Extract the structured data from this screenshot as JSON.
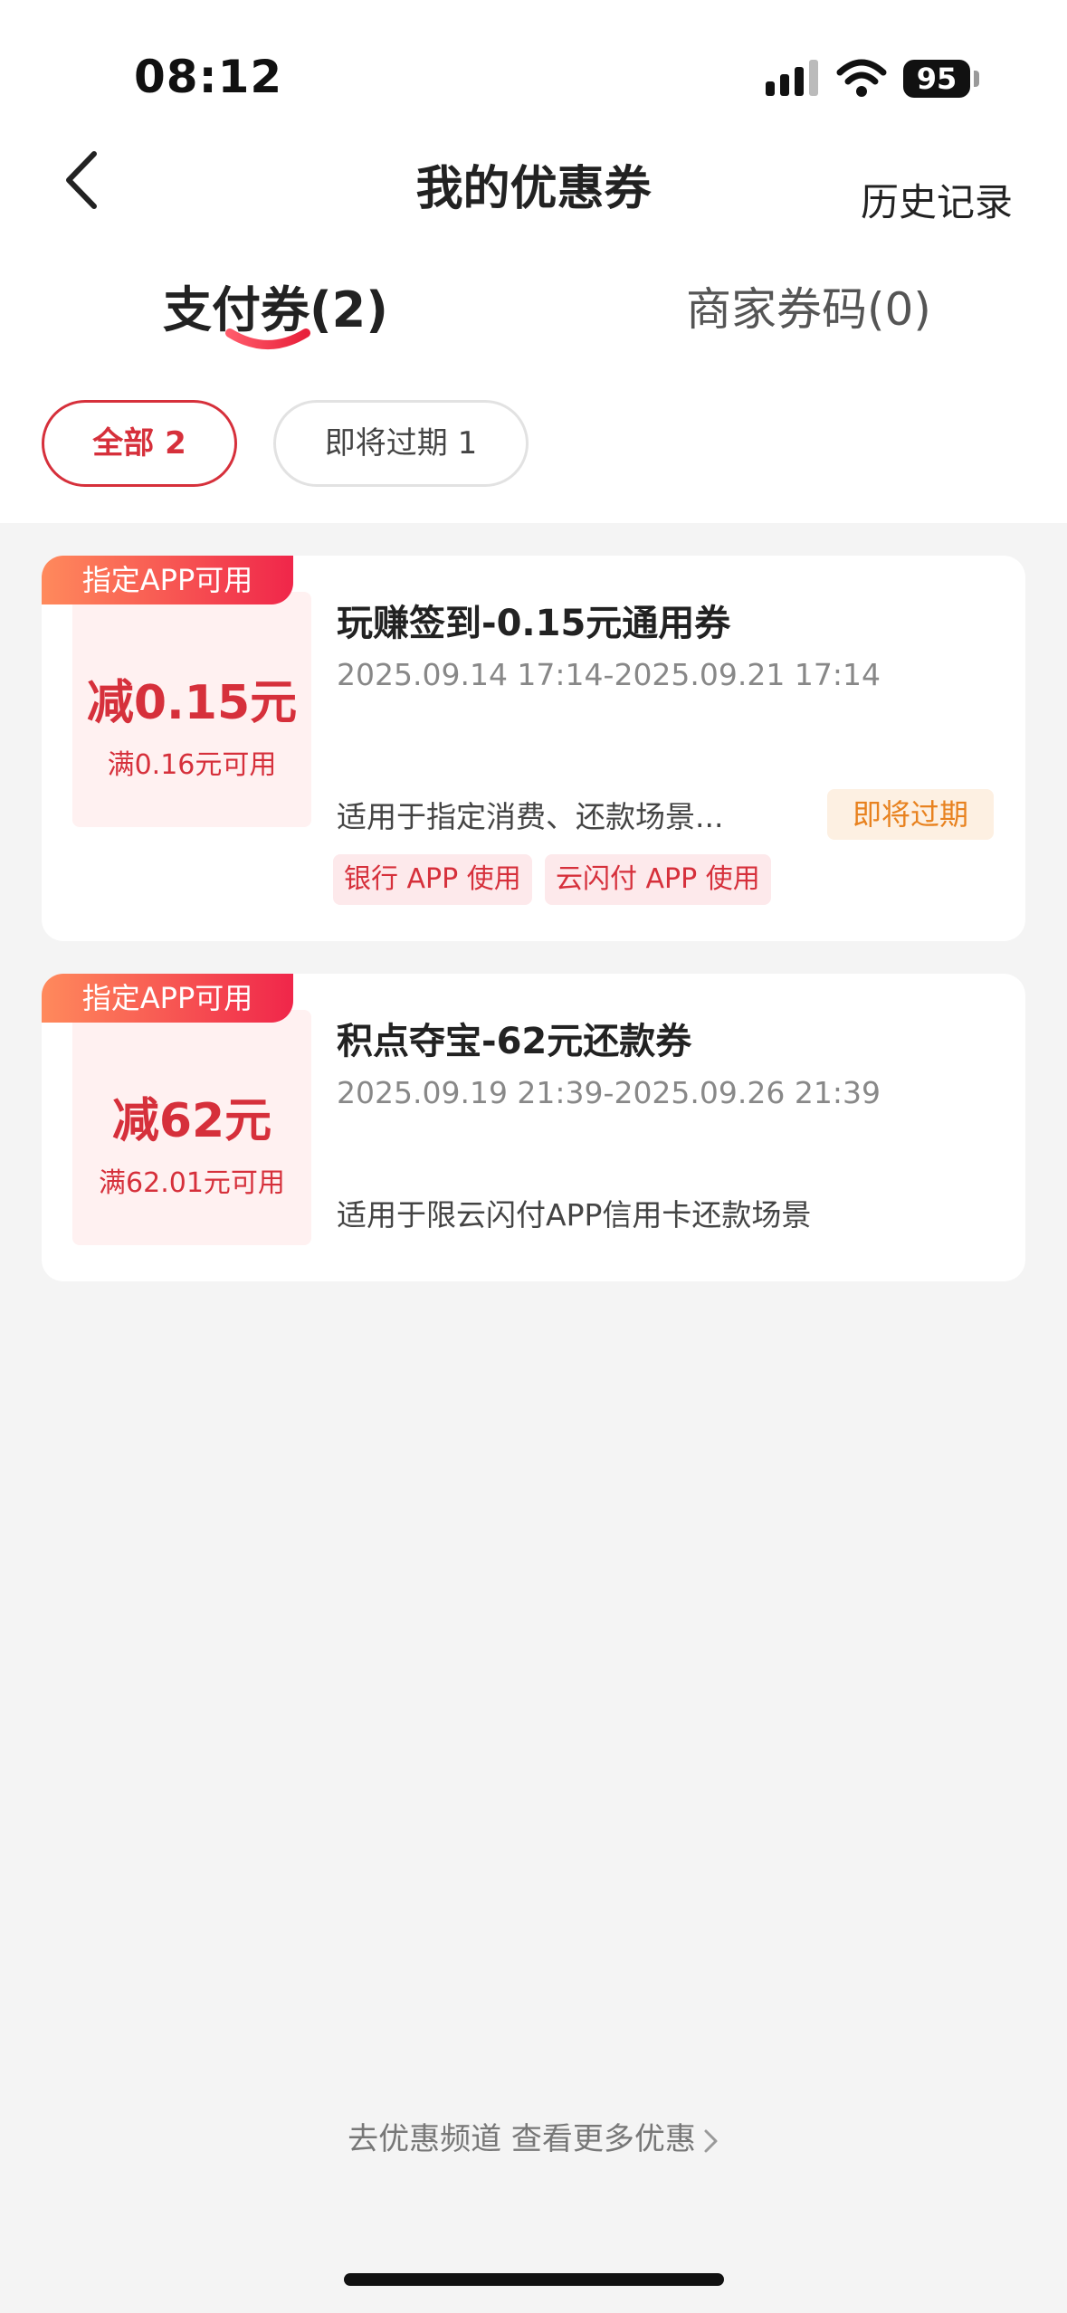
{
  "status_bar": {
    "time": "08:12",
    "battery": "95"
  },
  "header": {
    "title": "我的优惠券",
    "history_label": "历史记录"
  },
  "tabs": [
    {
      "label": "支付券(2)",
      "active": true
    },
    {
      "label": "商家券码(0)",
      "active": false
    }
  ],
  "filters": [
    {
      "label": "全部 2",
      "active": true
    },
    {
      "label": "即将过期 1",
      "active": false
    }
  ],
  "coupons": [
    {
      "badge": "指定APP可用",
      "amount": "减0.15元",
      "condition": "满0.16元可用",
      "title": "玩赚签到-0.15元通用券",
      "dates": "2025.09.14 17:14-2025.09.21 17:14",
      "description": "适用于指定消费、还款场景...",
      "status": "即将过期",
      "tags": [
        "银行 APP 使用",
        "云闪付 APP 使用"
      ]
    },
    {
      "badge": "指定APP可用",
      "amount": "减62元",
      "condition": "满62.01元可用",
      "title": "积点夺宝-62元还款券",
      "dates": "2025.09.19 21:39-2025.09.26 21:39",
      "description": "适用于限云闪付APP信用卡还款场景"
    }
  ],
  "footer": {
    "more_link": "去优惠频道 查看更多优惠"
  },
  "colors": {
    "accent": "#d6303b",
    "expiring": "#e8821f",
    "background": "#f4f4f4"
  }
}
